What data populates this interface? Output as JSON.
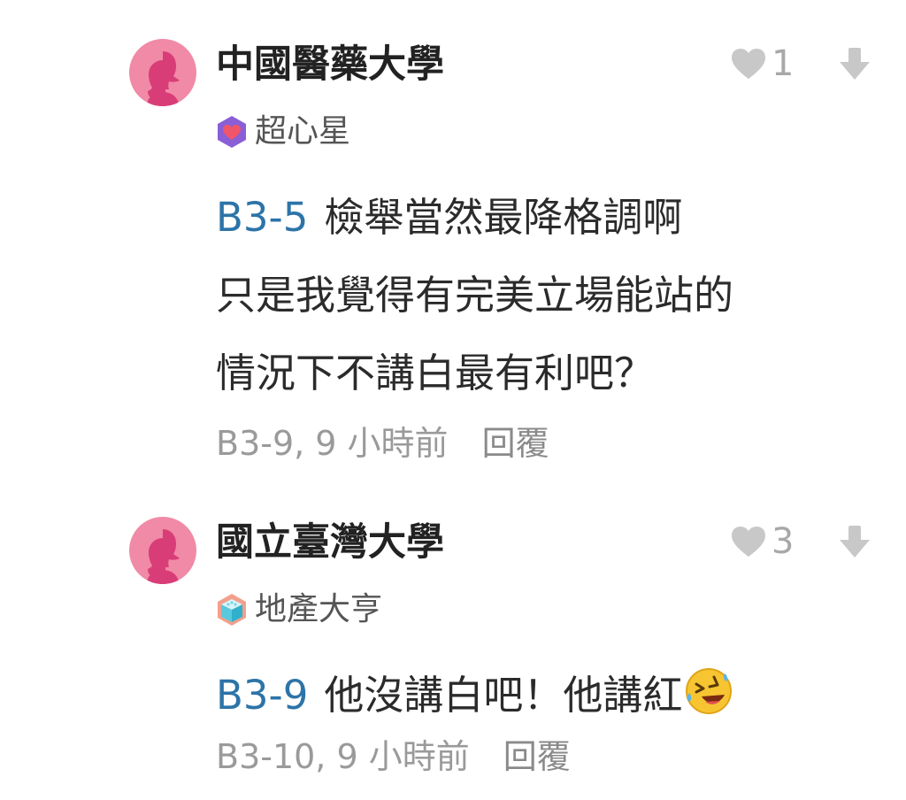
{
  "comments": [
    {
      "school": "中國醫藥大學",
      "persona": "超心星",
      "persona_badge": "purple-heart-hexagon-badge",
      "likes": "1",
      "tag": "B3-5",
      "lines": [
        "檢舉當然最降格調啊",
        "只是我覺得有完美立場能站的",
        "情況下不講白最有利吧？"
      ],
      "floor": "B3-9, 9 小時前",
      "reply": "回覆"
    },
    {
      "school": "國立臺灣大學",
      "persona": "地產大亨",
      "persona_badge": "cyan-building-block-badge",
      "likes": "3",
      "tag": "B3-9",
      "text": "他沒講白吧！他講紅",
      "emoji": "rolling-on-floor-laughing-emoji",
      "floor": "B3-10, 9 小時前",
      "reply": "回覆"
    }
  ],
  "colors": {
    "avatar_bg": "#f08aa6",
    "avatar_figure": "#d93d78",
    "tag_blue": "#2c74a8",
    "muted_gray": "#9a9a9a"
  }
}
